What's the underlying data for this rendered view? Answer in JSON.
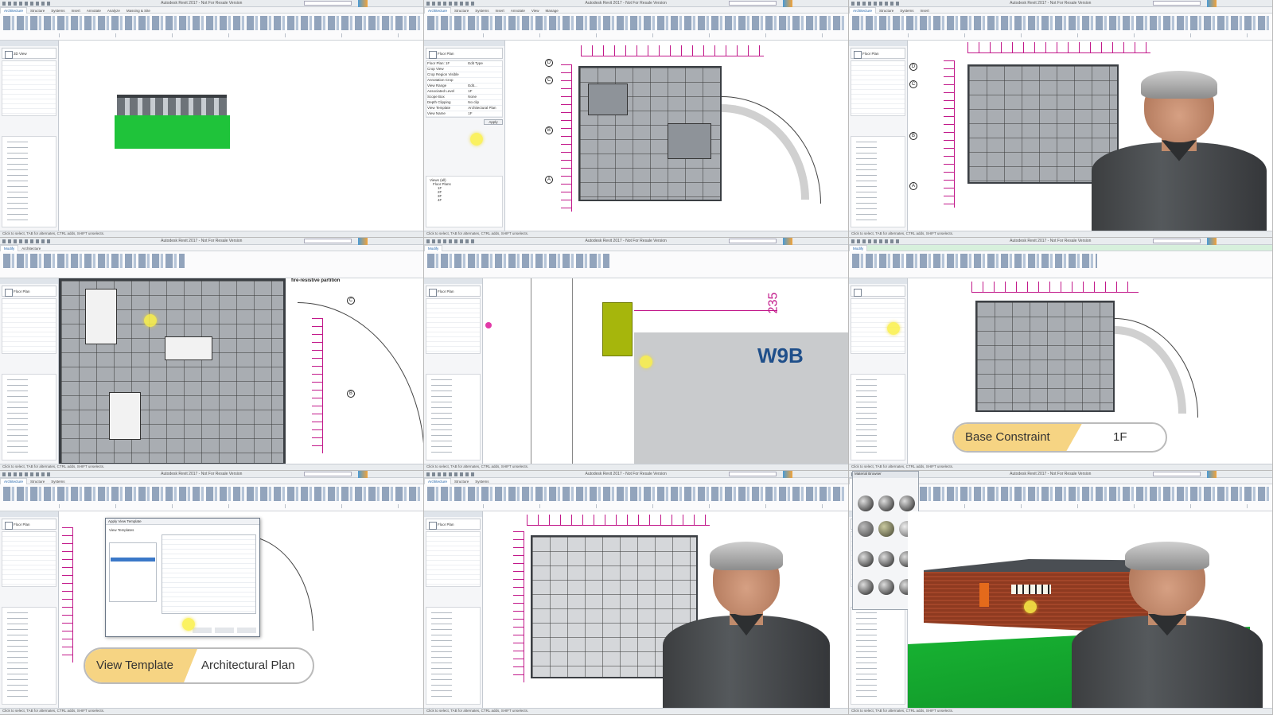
{
  "app": {
    "window_title": "Autodesk Revit 2017 - Not For Resale Version",
    "ribbon_tabs": [
      "Architecture",
      "Structure",
      "Systems",
      "Insert",
      "Annotate",
      "Analyze",
      "Massing & Site",
      "Collaborate",
      "View",
      "Manage",
      "Add-Ins",
      "Modify"
    ],
    "active_tab": "Architecture",
    "status_hint": "Click to select, TAB for alternates, CTRL adds, SHIFT unselects."
  },
  "tiles": {
    "t1": {
      "view": "3D View"
    },
    "t2": {
      "type_name": "Floor Plan",
      "properties": [
        {
          "label": "Floor Plan: 1F",
          "value": "Edit Type"
        },
        {
          "label": "Crop View",
          "value": ""
        },
        {
          "label": "Crop Region Visible",
          "value": ""
        },
        {
          "label": "Annotation Crop",
          "value": ""
        },
        {
          "label": "View Range",
          "value": "Edit..."
        },
        {
          "label": "Associated Level",
          "value": "1F"
        },
        {
          "label": "Scope Box",
          "value": "None"
        },
        {
          "label": "Depth Clipping",
          "value": "No clip"
        },
        {
          "label": "View Template",
          "value": "Architectural Plan"
        },
        {
          "label": "View Name",
          "value": "1F"
        }
      ],
      "apply_label": "Apply",
      "browser_items": [
        "Views (all)",
        "Floor Plans",
        "1F",
        "2F",
        "3F",
        "4F"
      ],
      "grid_labels": [
        "D",
        "C",
        "B",
        "A"
      ]
    },
    "t3": {
      "grid_labels": [
        "D",
        "C",
        "B",
        "A"
      ]
    },
    "t4": {
      "annotation": "fire-resistive partition",
      "grid_labels": [
        "C",
        "B"
      ]
    },
    "t5": {
      "dimension": "235",
      "tag": "W9B"
    },
    "t6": {
      "lower_third_key": "Base Constraint",
      "lower_third_value": "1F"
    },
    "t7": {
      "dialog_title": "Apply View Template",
      "dialog_subtitle": "View Templates",
      "lower_third_key": "View Template",
      "lower_third_value": "Architectural Plan"
    },
    "t8": {
      "type_name": "Floor Plan"
    },
    "t9": {
      "panel": "Material Browser"
    }
  },
  "icons": [
    "plan-view-icon",
    "cursor-highlight-icon",
    "grid-bubble-icon",
    "sphere-material-icon"
  ],
  "colors": {
    "dimension_magenta": "#c2188a",
    "cursor_yellow": "#faf046",
    "ground_green": "#1fc33a",
    "lower_third_gold": "#f6d483",
    "brick_red": "#9b3b22"
  }
}
